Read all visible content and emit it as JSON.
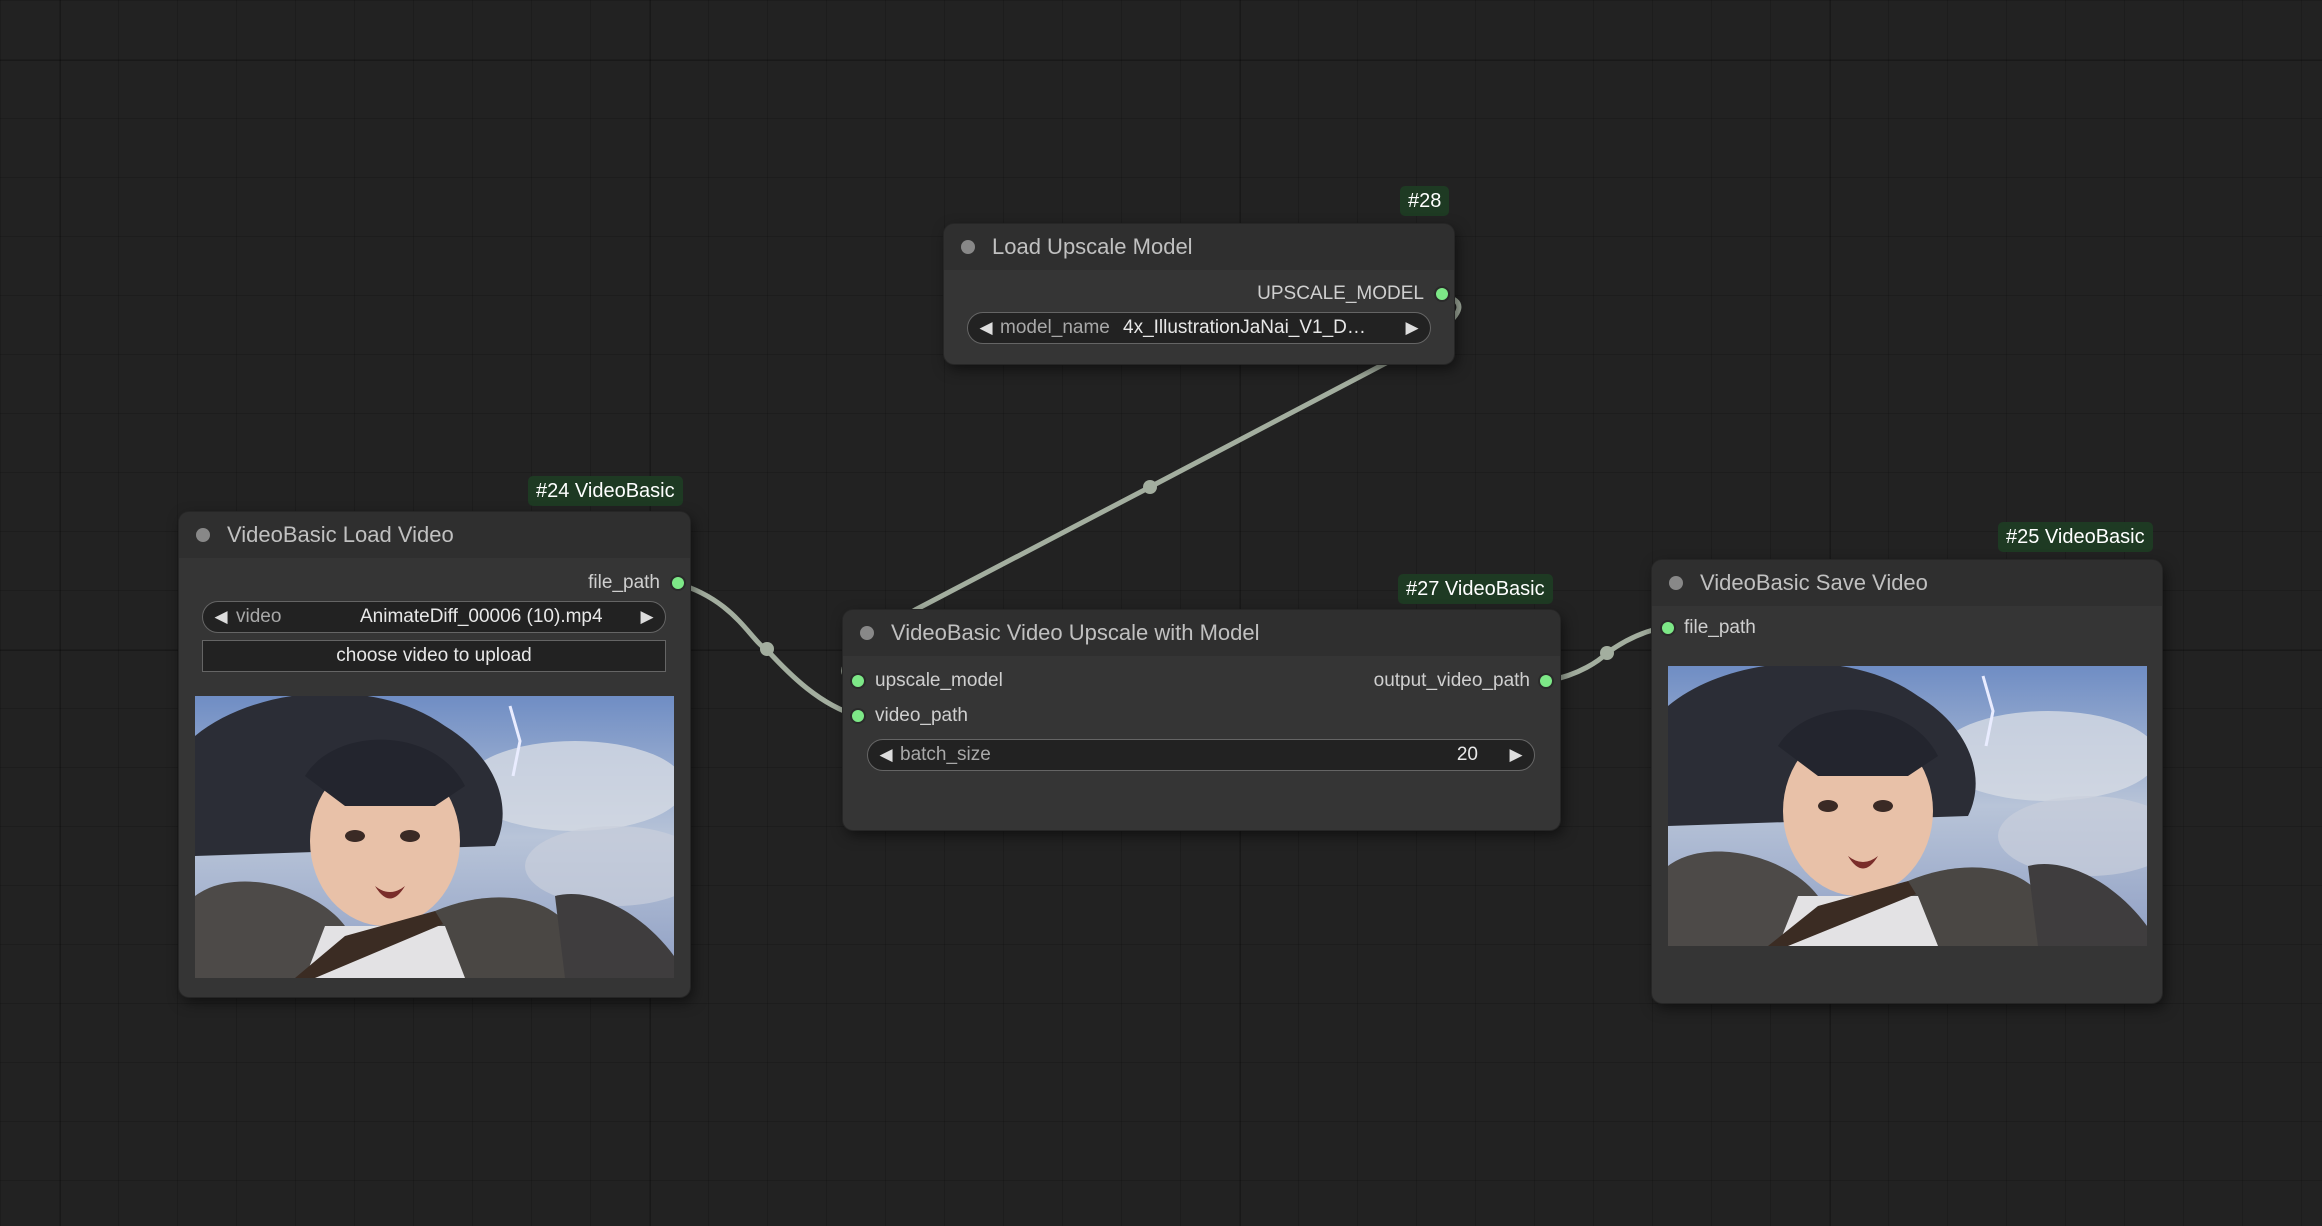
{
  "nodes": {
    "upscale_loader": {
      "badge": "#28",
      "title": "Load Upscale Model",
      "output": "UPSCALE_MODEL",
      "widget_label": "model_name",
      "widget_value": "4x_IllustrationJaNai_V1_D…"
    },
    "load_video": {
      "badge": "#24 VideoBasic",
      "title": "VideoBasic Load Video",
      "output": "file_path",
      "widget_label": "video",
      "widget_value": "AnimateDiff_00006 (10).mp4",
      "upload_button": "choose video to upload"
    },
    "video_upscale": {
      "badge": "#27 VideoBasic",
      "title": "VideoBasic Video Upscale with Model",
      "input_1": "upscale_model",
      "input_2": "video_path",
      "output": "output_video_path",
      "widget_label": "batch_size",
      "widget_value": "20"
    },
    "save_video": {
      "badge": "#25 VideoBasic",
      "title": "VideoBasic Save Video",
      "input": "file_path"
    }
  },
  "colors": {
    "canvas_bg": "#222222",
    "node_bg": "#353535",
    "node_title_bg": "#2f2f2f",
    "badge_bg": "#1e3a23",
    "slot_connected": "#7de887",
    "link": "#a3ae9f"
  },
  "icons": {
    "left_arrow": "triangle-left-icon",
    "right_arrow": "triangle-right-icon"
  }
}
